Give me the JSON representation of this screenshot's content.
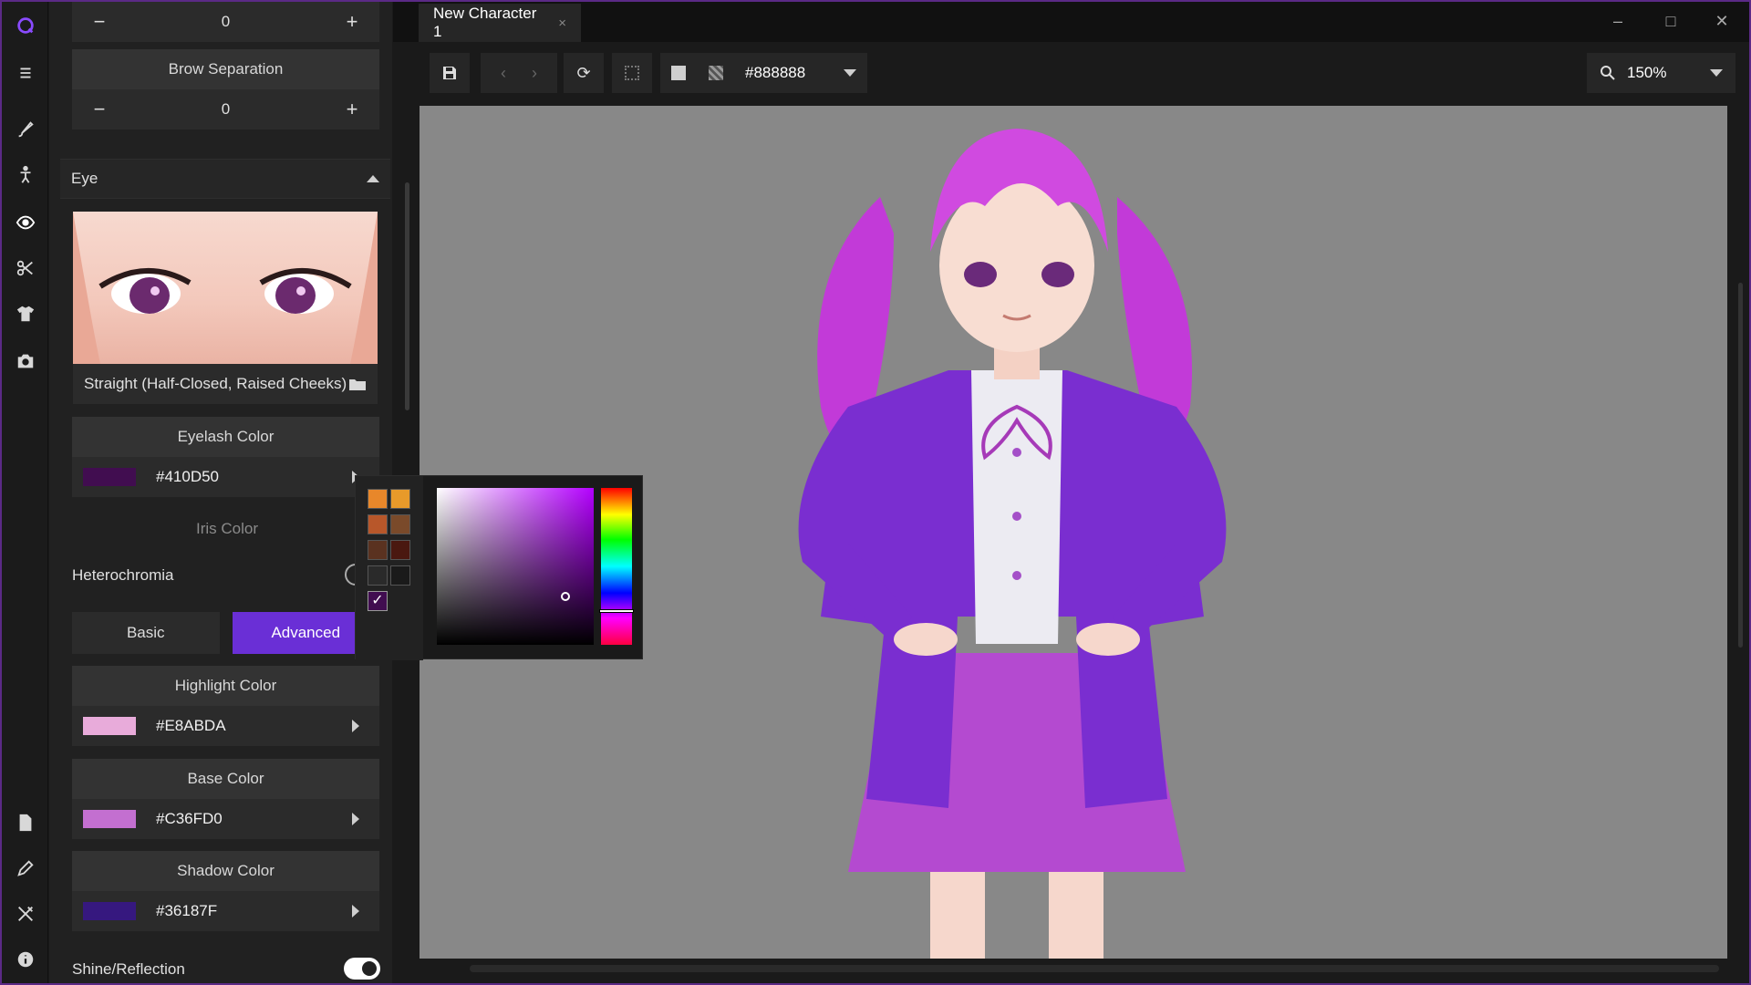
{
  "window": {
    "tab_title": "New Character 1",
    "tab_close": "×"
  },
  "panel": {
    "top_stepper_value": "0",
    "brow_separation": {
      "label": "Brow Separation",
      "value": "0"
    },
    "stepper_minus": "−",
    "stepper_plus": "+",
    "eye_section": "Eye",
    "eye_preset": "Straight (Half-Closed, Raised Cheeks)",
    "eyelash_color": {
      "label": "Eyelash Color",
      "value": "#410D50",
      "swatch": "#410D50"
    },
    "iris_color_label": "Iris Color",
    "heterochromia_label": "Heterochromia",
    "tabs": {
      "basic": "Basic",
      "advanced": "Advanced"
    },
    "highlight_color": {
      "label": "Highlight Color",
      "value": "#E8ABDA",
      "swatch": "#E8ABDA"
    },
    "base_color": {
      "label": "Base Color",
      "value": "#C36FD0",
      "swatch": "#C36FD0"
    },
    "shadow_color": {
      "label": "Shadow Color",
      "value": "#36187F",
      "swatch": "#36187F"
    },
    "shine_reflection_label": "Shine/Reflection",
    "shine_reflection_on": true
  },
  "toolbar": {
    "background_hex": "#888888",
    "zoom": "150%"
  },
  "picker": {
    "preset_swatches": [
      "#E8872A",
      "#E89A2A",
      "#B8572A",
      "#7A4A2A",
      "#5A3220",
      "#4A1810",
      "#2A2A2A",
      "#1A1A1A"
    ],
    "hue_color": "#B400FF"
  },
  "colors": {
    "accent": "#6A2FD6",
    "canvas_bg": "#888888",
    "frame": "#5B2A86"
  },
  "icons": [
    "app-logo-icon",
    "menu-icon",
    "brush-icon",
    "pose-icon",
    "eye-icon",
    "scissors-icon",
    "shirt-icon",
    "camera-icon",
    "file-icon",
    "pencil-icon",
    "tools-icon",
    "info-icon",
    "save-icon",
    "back-icon",
    "forward-icon",
    "refresh-icon",
    "selection-icon",
    "solid-bg-icon",
    "transparent-bg-icon",
    "search-icon",
    "folder-icon"
  ]
}
